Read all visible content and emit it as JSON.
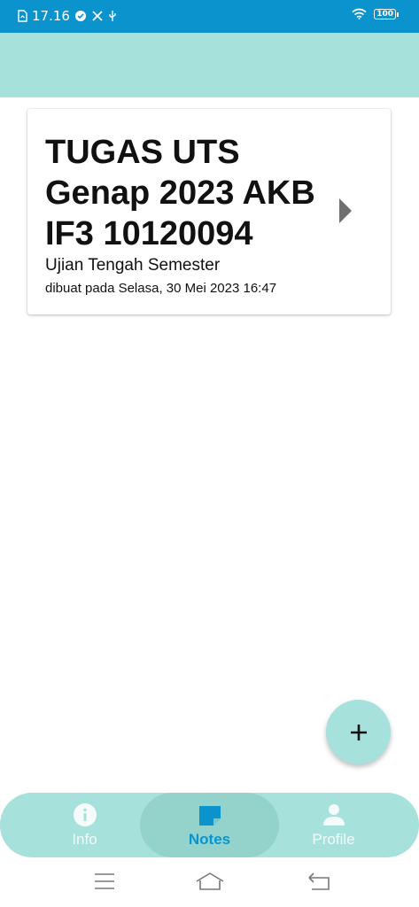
{
  "status_bar": {
    "time": "17.16",
    "battery": "100",
    "icons": [
      "sim-file-icon",
      "check-circle-icon",
      "tools-icon",
      "usb-icon",
      "wifi-icon",
      "battery-icon"
    ]
  },
  "note_card": {
    "title": "TUGAS UTS Genap 2023 AKB IF3 10120094",
    "subtitle": "Ujian Tengah Semester",
    "created": "dibuat pada Selasa, 30 Mei 2023 16:47"
  },
  "fab": {
    "icon": "plus-icon",
    "label": "+"
  },
  "bottom_nav": {
    "items": [
      {
        "label": "Info",
        "icon": "info-icon",
        "active": false
      },
      {
        "label": "Notes",
        "icon": "note-icon",
        "active": true
      },
      {
        "label": "Profile",
        "icon": "person-icon",
        "active": false
      }
    ]
  },
  "colors": {
    "status_bar": "#0a93cc",
    "accent_teal": "#a7e1db",
    "active_nav": "#0a93cc"
  },
  "system_nav": [
    "menu-icon",
    "home-icon",
    "back-icon"
  ]
}
